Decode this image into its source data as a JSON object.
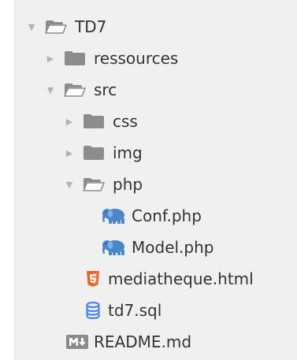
{
  "tree": {
    "root": {
      "label": "TD7",
      "state": "expanded"
    },
    "ressources": {
      "label": "ressources",
      "state": "collapsed"
    },
    "src": {
      "label": "src",
      "state": "expanded"
    },
    "css": {
      "label": "css",
      "state": "collapsed"
    },
    "img": {
      "label": "img",
      "state": "collapsed"
    },
    "php": {
      "label": "php",
      "state": "expanded"
    },
    "conf": {
      "label": "Conf.php",
      "icon": "php-elephant-icon"
    },
    "model": {
      "label": "Model.php",
      "icon": "php-elephant-icon"
    },
    "mediatheque": {
      "label": "mediatheque.html",
      "icon": "html5-icon"
    },
    "sql": {
      "label": "td7.sql",
      "icon": "database-icon"
    },
    "readme": {
      "label": "README.md",
      "icon": "markdown-icon"
    }
  },
  "colors": {
    "panel_background": "#f0f0f0",
    "text": "#333333",
    "folder": "#888888",
    "php": "#4a86c8",
    "html5": "#e96228",
    "database": "#4a86e8",
    "markdown": "#8a8a8a"
  }
}
